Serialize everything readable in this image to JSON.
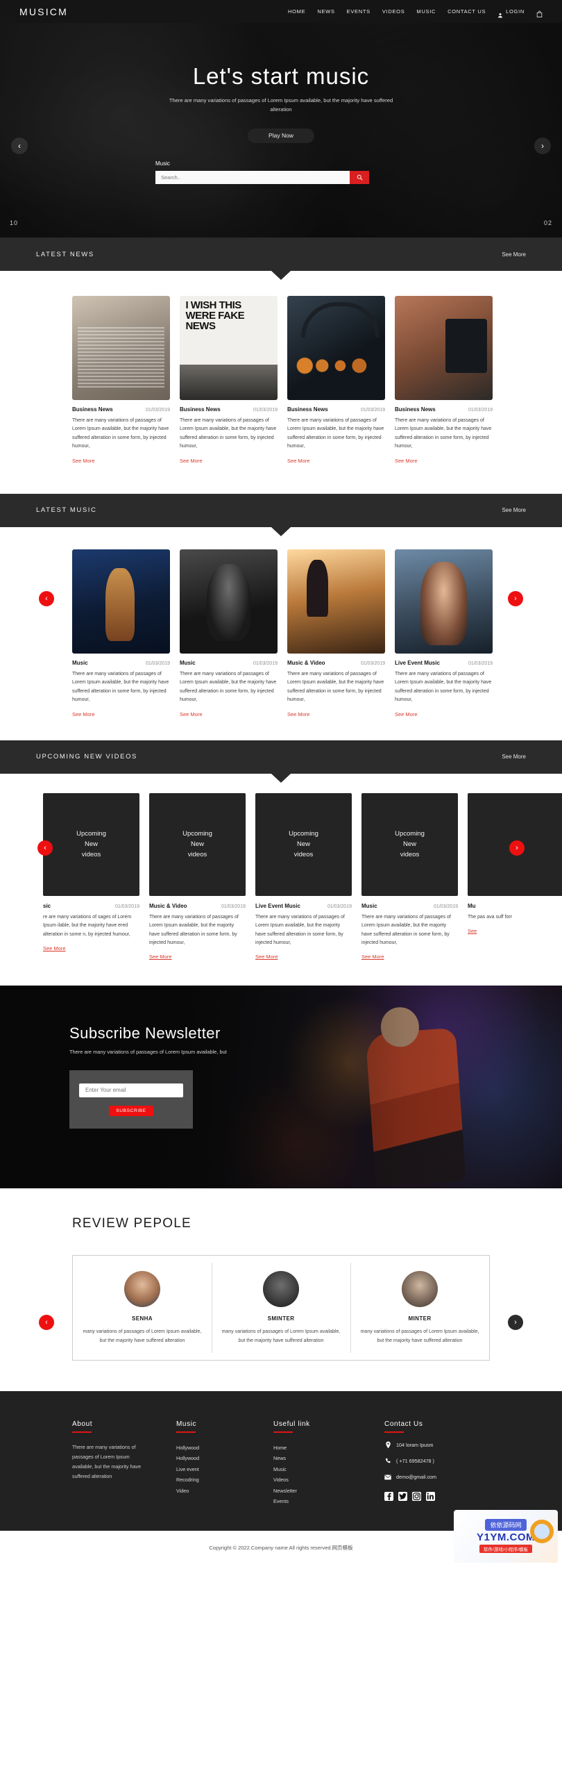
{
  "header": {
    "brand": "MUSICM",
    "nav": [
      "HOME",
      "NEWS",
      "EVENTS",
      "VIDEOS",
      "MUSIC",
      "CONTACT US"
    ],
    "login_label": "LOGIN",
    "person_icon": "person-icon",
    "bag_icon": "shopping-bag-icon"
  },
  "hero": {
    "title": "Let's start music",
    "subtitle": "There are many variations of passages of Lorem Ipsum available, but the majority have suffered alteration",
    "play_label": "Play Now",
    "search_label": "Music",
    "search_placeholder": "Search..",
    "search_value": "",
    "search_icon": "search-icon",
    "prev_icon": "chevron-left-icon",
    "next_icon": "chevron-right-icon",
    "slide_left": "10",
    "slide_right": "02"
  },
  "latest_news": {
    "title": "LATEST NEWS",
    "see_more": "See More",
    "cards": [
      {
        "title": "Business News",
        "date": "01/03/2019",
        "text": "There are many variations of passages of Lorem Ipsum available, but the majority have suffered alteration in some form, by injected humour,",
        "more": "See More"
      },
      {
        "title": "Business News",
        "date": "01/03/2019",
        "text": "There are many variations of passages of Lorem Ipsum available, but the majority have suffered alteration in some form, by injected humour,",
        "more": "See More"
      },
      {
        "title": "Business News",
        "date": "01/03/2019",
        "text": "There are many variations of passages of Lorem Ipsum available, but the majority have suffered alteration in some form, by injected humour,",
        "more": "See More"
      },
      {
        "title": "Business News",
        "date": "01/03/2019",
        "text": "There are many variations of passages of Lorem Ipsum available, but the majority have suffered alteration in some form, by injected humour,",
        "more": "See More"
      }
    ]
  },
  "latest_music": {
    "title": "LATEST MUSIC",
    "see_more": "See More",
    "prev_icon": "chevron-left-icon",
    "next_icon": "chevron-right-icon",
    "cards": [
      {
        "title": "Music",
        "date": "01/03/2019",
        "text": "There are many variations of passages of Lorem Ipsum available, but the majority have suffered alteration in some form, by injected humour,",
        "more": "See More"
      },
      {
        "title": "Music",
        "date": "01/03/2019",
        "text": "There are many variations of passages of Lorem Ipsum available, but the majority have suffered alteration in some form, by injected humour,",
        "more": "See More"
      },
      {
        "title": "Music & Video",
        "date": "01/03/2019",
        "text": "There are many variations of passages of Lorem Ipsum available, but the majority have suffered alteration in some form, by injected humour,",
        "more": "See More"
      },
      {
        "title": "Live Event Music",
        "date": "01/03/2019",
        "text": "There are many variations of passages of Lorem Ipsum available, but the majority have suffered alteration in some form, by injected humour,",
        "more": "See More"
      }
    ]
  },
  "upcoming_videos": {
    "title": "UPCOMING NEW VIDEOS",
    "see_more": "See More",
    "thumb_label": "Upcoming\nNew\nvideos",
    "prev_icon": "chevron-left-icon",
    "next_icon": "chevron-right-icon",
    "cards": [
      {
        "title": "sic",
        "date": "01/03/2019",
        "text": "re are many variations of sages of Lorem Ipsum ilable, but the majority have ered alteration in some n, by injected humour,",
        "more": "See More",
        "thumb": "Upcoming New videos"
      },
      {
        "title": "Music & Video",
        "date": "01/03/2019",
        "text": "There are many variations of passages of Lorem Ipsum available, but the majority have suffered alteration in some form, by injected humour,",
        "more": "See More",
        "thumb": "Upcoming New videos"
      },
      {
        "title": "Live Event Music",
        "date": "01/03/2019",
        "text": "There are many variations of passages of Lorem Ipsum available, but the majority have suffered alteration in some form, by injected humour,",
        "more": "See More",
        "thumb": "Upcoming New videos"
      },
      {
        "title": "Music",
        "date": "01/03/2019",
        "text": "There are many variations of passages of Lorem Ipsum available, but the majority have suffered alteration in some form, by injected humour,",
        "more": "See More",
        "thumb": "Upcoming New videos"
      },
      {
        "title": "Mu",
        "date": "",
        "text": "The pas ava suff forr",
        "more": "See",
        "thumb": ""
      }
    ]
  },
  "newsletter": {
    "title": "Subscribe Newsletter",
    "subtitle": "There are many variations of passages of Lorem Ipsum available, but",
    "input_placeholder": "Enter Your email",
    "input_value": "",
    "button_label": "SUBSCRIBE"
  },
  "reviews": {
    "title": "REVIEW PEPOLE",
    "prev_icon": "chevron-left-icon",
    "next_icon": "chevron-right-icon",
    "people": [
      {
        "name": "SENHA",
        "text": "many variations of passages of Lorem Ipsum available, but the majority have suffered alteration"
      },
      {
        "name": "SMINTER",
        "text": "many variations of passages of Lorem Ipsum available, but the majority have suffered alteration"
      },
      {
        "name": "MINTER",
        "text": "many variations of passages of Lorem Ipsum available, but the majority have suffered alteration"
      }
    ]
  },
  "footer": {
    "about": {
      "heading": "About",
      "text": "There are many variations of passages of Lorem Ipsum available, but the majority have suffered alteration"
    },
    "music": {
      "heading": "Music",
      "links": [
        "Hollywood",
        "Hollywood",
        "Live event",
        "Recodring",
        "Video"
      ]
    },
    "useful": {
      "heading": "Useful link",
      "links": [
        "Home",
        "News",
        "Music",
        "Videos",
        "Newsletter",
        "Events"
      ]
    },
    "contact": {
      "heading": "Contact Us",
      "address": "104 loram Ipusm",
      "phone": "( +71 69582478 )",
      "email": "demo@gmail.com",
      "address_icon": "location-pin-icon",
      "phone_icon": "phone-icon",
      "email_icon": "envelope-icon",
      "socials": [
        "facebook-icon",
        "twitter-icon",
        "instagram-icon",
        "linkedin-icon"
      ]
    }
  },
  "copyright": {
    "text": "Copyright © 2022.Company name All rights reserved.网页模板"
  },
  "watermark": {
    "chip": "依依源码网",
    "main": "Y1YM.COM",
    "sub": "软件/游戏/小程序/模板"
  },
  "colors": {
    "accent_red": "#ee1010",
    "link_red": "#d9392c",
    "dark": "#222222",
    "bar": "#2b2b2b"
  }
}
